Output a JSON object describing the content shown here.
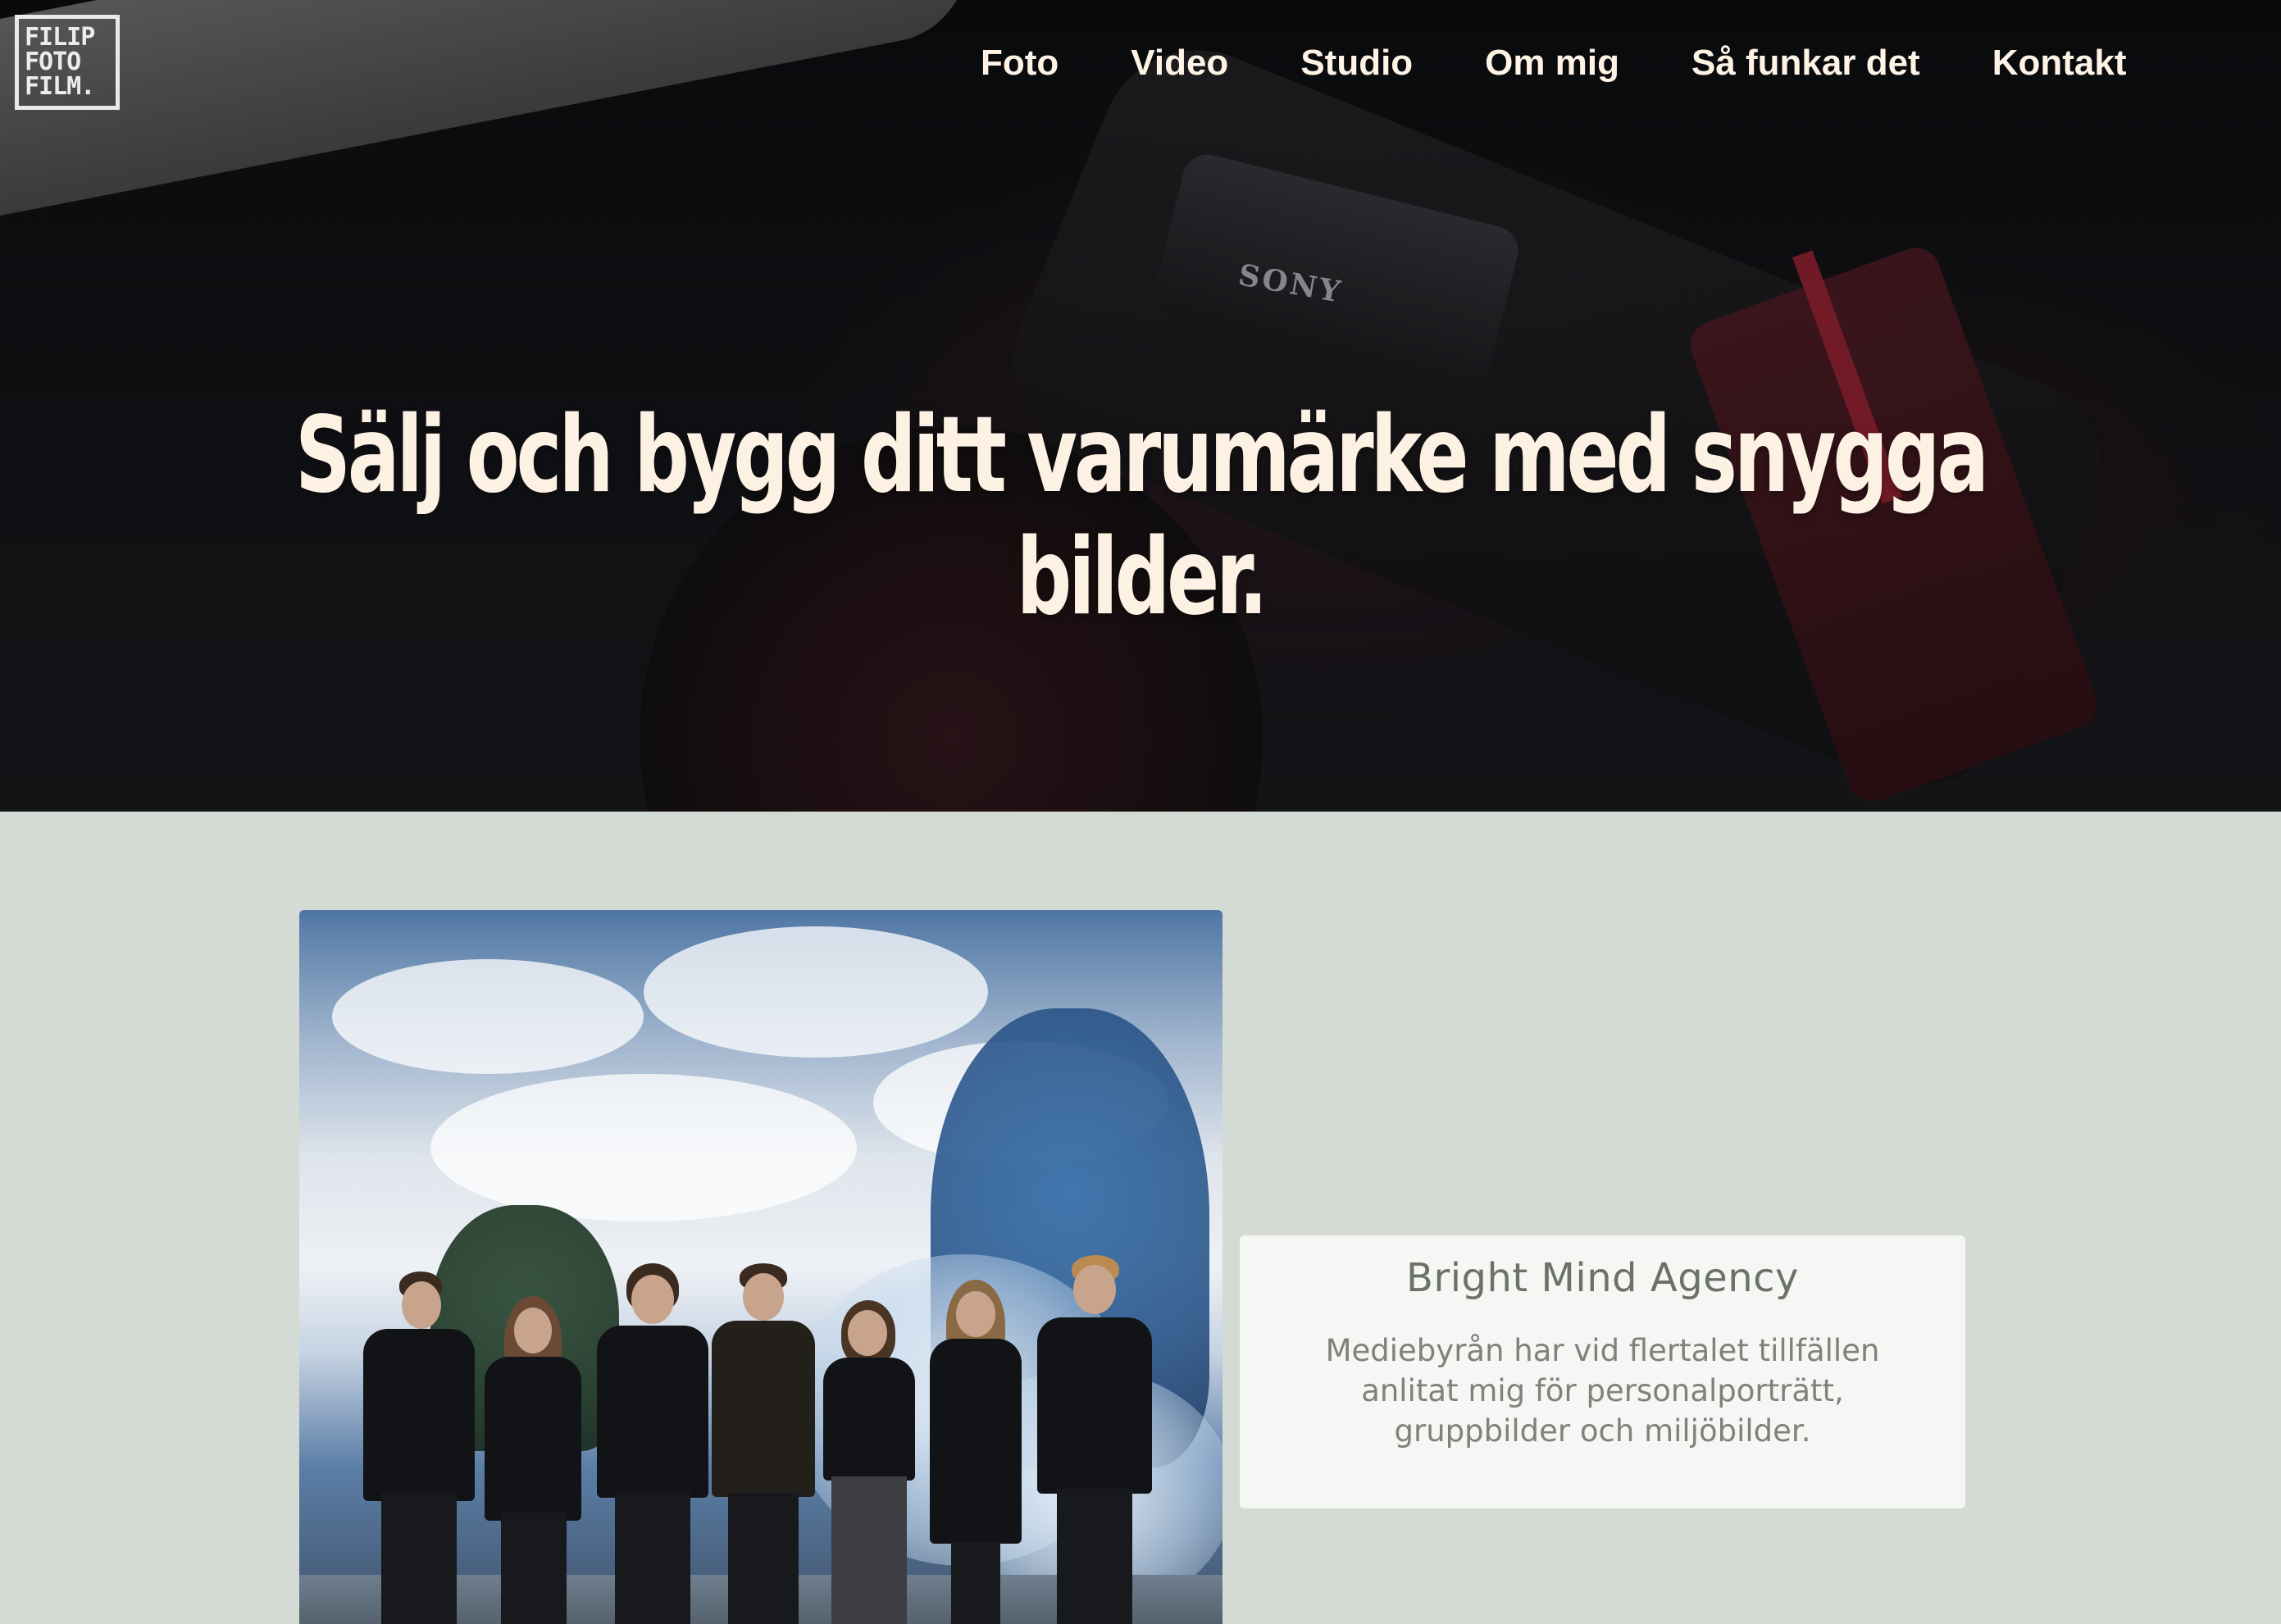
{
  "logo": {
    "lines": [
      "FILIP",
      "FOTO",
      "FILM."
    ]
  },
  "nav": {
    "items": [
      {
        "label": "Foto"
      },
      {
        "label": "Video"
      },
      {
        "label": "Studio"
      },
      {
        "label": "Om mig"
      },
      {
        "label": "Så funkar det"
      },
      {
        "label": "Kontakt"
      }
    ]
  },
  "hero": {
    "headline": "Sälj och bygg ditt varumärke med snygga bilder.",
    "camera_brand": "SONY"
  },
  "showcase": {
    "title": "Bright Mind Agency",
    "description": "Mediebyrån har vid flertalet tillfällen anlitat mig för personalporträtt, gruppbilder och miljöbilder."
  },
  "colors": {
    "page_background": "#d4dad4",
    "hero_text": "#fdf1e4",
    "nav_text": "#fff3e6",
    "card_background": "#f6f6f5",
    "card_title": "#6b7367",
    "card_text": "#7d837b"
  }
}
